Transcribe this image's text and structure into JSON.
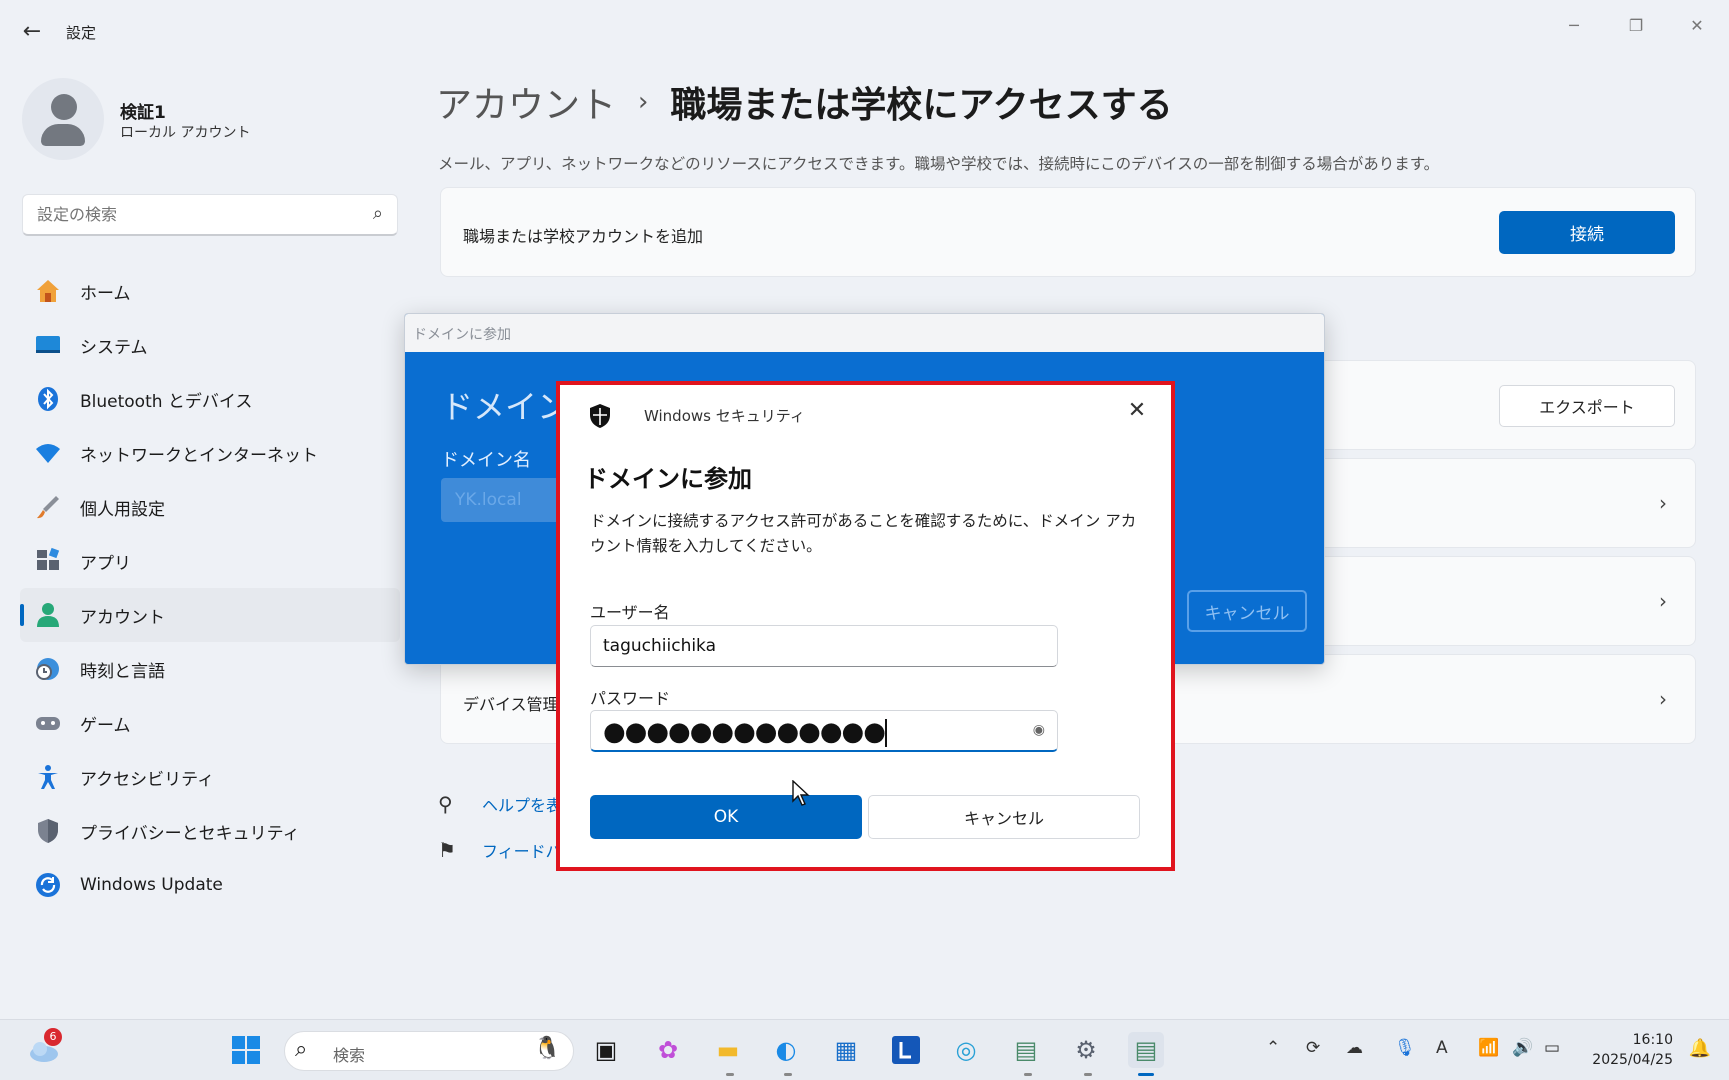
{
  "window": {
    "back_icon": "arrow-left-icon",
    "title": "設定",
    "controls": [
      "minimize-icon",
      "restore-icon",
      "close-icon"
    ]
  },
  "profile": {
    "name": "検証1",
    "account_type": "ローカル アカウント"
  },
  "search": {
    "placeholder": "設定の検索"
  },
  "sidebar": {
    "items": [
      {
        "label": "ホーム",
        "icon": "home-icon",
        "active": false
      },
      {
        "label": "システム",
        "icon": "monitor-icon",
        "active": false
      },
      {
        "label": "Bluetooth とデバイス",
        "icon": "bluetooth-icon",
        "active": false
      },
      {
        "label": "ネットワークとインターネット",
        "icon": "wifi-icon",
        "active": false
      },
      {
        "label": "個人用設定",
        "icon": "brush-icon",
        "active": false
      },
      {
        "label": "アプリ",
        "icon": "apps-icon",
        "active": false
      },
      {
        "label": "アカウント",
        "icon": "person-icon",
        "active": true
      },
      {
        "label": "時刻と言語",
        "icon": "clock-globe-icon",
        "active": false
      },
      {
        "label": "ゲーム",
        "icon": "gamepad-icon",
        "active": false
      },
      {
        "label": "アクセシビリティ",
        "icon": "accessibility-icon",
        "active": false
      },
      {
        "label": "プライバシーとセキュリティ",
        "icon": "shield-icon",
        "active": false
      },
      {
        "label": "Windows Update",
        "icon": "update-icon",
        "active": false
      }
    ]
  },
  "main": {
    "breadcrumb_parent": "アカウント",
    "breadcrumb_current": "職場または学校にアクセスする",
    "description": "メール、アプリ、ネットワークなどのリソースにアクセスできます。職場や学校では、接続時にこのデバイスの一部を制御する場合があります。",
    "add_account_label": "職場または学校アカウントを追加",
    "connect_button": "接続",
    "export_button": "エクスポート",
    "device_mgmt_label": "デバイス管理",
    "help_link": "ヘルプを表",
    "feedback_link": "フィードバ"
  },
  "domain_dialog": {
    "window_title": "ドメインに参加",
    "heading": "ドメインに",
    "domain_label": "ドメイン名",
    "domain_value": "YK.local",
    "cancel_button": "キャンセル"
  },
  "security_dialog": {
    "app_name": "Windows セキュリティ",
    "title": "ドメインに参加",
    "description": "ドメインに接続するアクセス許可があることを確認するために、ドメイン アカウント情報を入力してください。",
    "username_label": "ユーザー名",
    "username_value": "taguchiichika",
    "password_label": "パスワード",
    "password_mask": "●●●●●●●●●●●●●",
    "ok_button": "OK",
    "cancel_button": "キャンセル",
    "highlight_color": "#e0141e"
  },
  "taskbar": {
    "widget_badge": "6",
    "search_placeholder": "検索",
    "time": "16:10",
    "date": "2025/04/25",
    "ime_indicator": "A"
  },
  "colors": {
    "accent": "#0067c0",
    "dialog_blue": "#0a6ed1",
    "background": "#eef1f6"
  }
}
